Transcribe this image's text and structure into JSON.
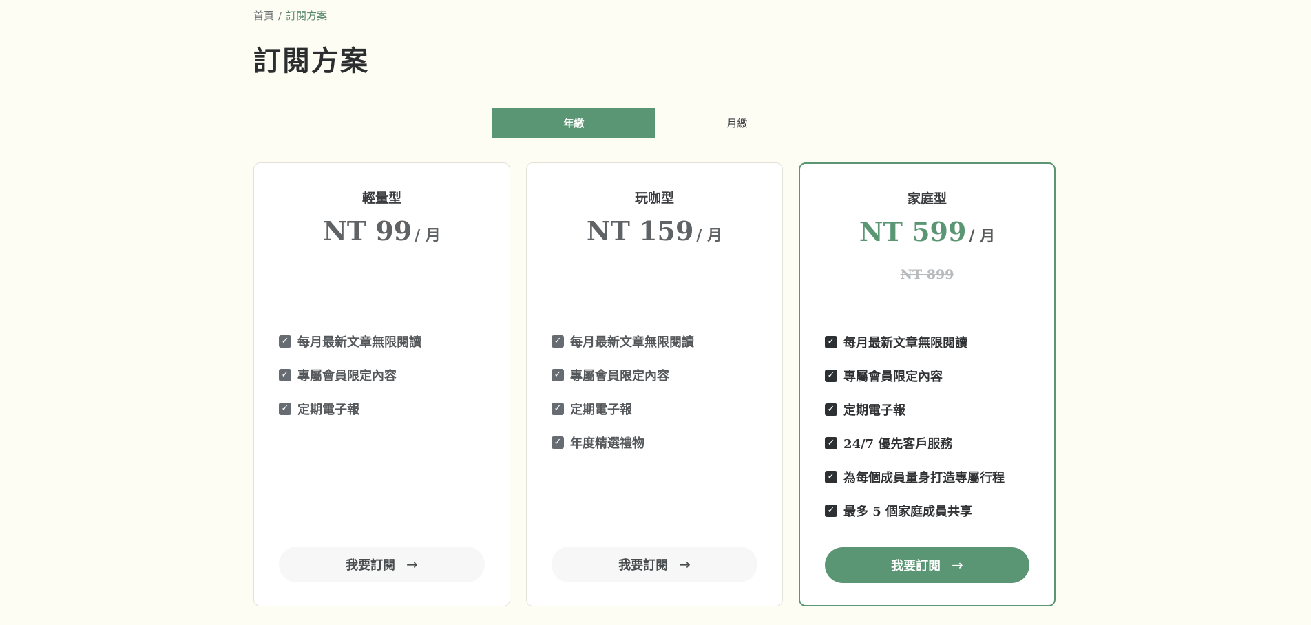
{
  "breadcrumb": {
    "home": "首頁",
    "separator": "/",
    "current": "訂閱方案"
  },
  "page_title": "訂閱方案",
  "billing_toggle": {
    "yearly": "年繳",
    "monthly": "月繳",
    "selected": "yearly"
  },
  "plans": [
    {
      "name": "輕量型",
      "price": "NT 99",
      "per": "/ 月",
      "original_price": "",
      "features": [
        "每月最新文章無限閱讀",
        "專屬會員限定內容",
        "定期電子報"
      ],
      "cta": "我要訂閱"
    },
    {
      "name": "玩咖型",
      "price": "NT 159",
      "per": "/ 月",
      "original_price": "",
      "features": [
        "每月最新文章無限閱讀",
        "專屬會員限定內容",
        "定期電子報",
        "年度精選禮物"
      ],
      "cta": "我要訂閱"
    },
    {
      "name": "家庭型",
      "price": "NT 599",
      "per": "/ 月",
      "original_price": "NT 899",
      "features": [
        "每月最新文章無限閱讀",
        "專屬會員限定內容",
        "定期電子報",
        "24/7 優先客戶服務",
        "為每個成員量身打造專屬行程",
        "最多 5 個家庭成員共享"
      ],
      "cta": "我要訂閱"
    }
  ],
  "icons": {
    "check": "checkbox-checked-icon",
    "arrow": "arrow-right-icon"
  },
  "colors": {
    "accent": "#5a9674",
    "background": "#fdfdf4"
  }
}
